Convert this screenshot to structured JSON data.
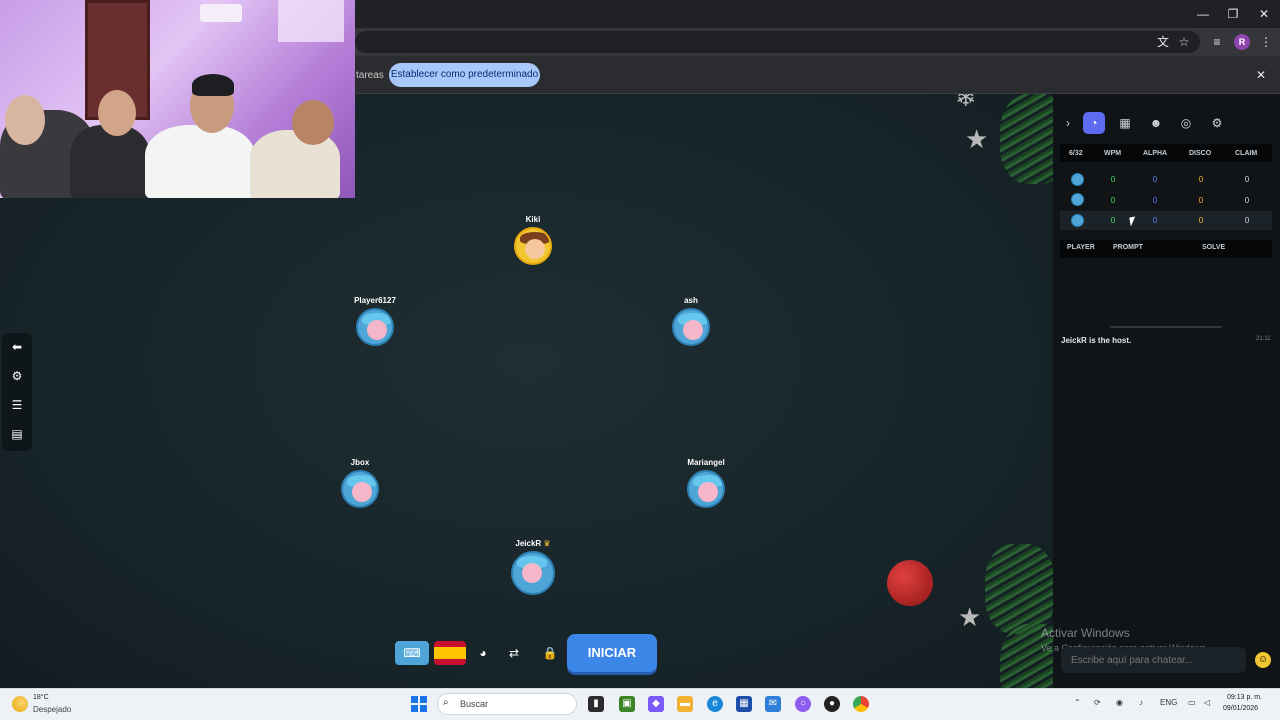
{
  "browser": {
    "infobar_partial_text": "tareas",
    "default_button": "Establecer como predeterminado",
    "profile_initial": "R"
  },
  "game": {
    "players": [
      {
        "name": "Kiki",
        "host": false,
        "avatar": "kiki"
      },
      {
        "name": "Player6127",
        "host": false,
        "avatar": "default"
      },
      {
        "name": "ash",
        "host": false,
        "avatar": "default"
      },
      {
        "name": "Jbox",
        "host": false,
        "avatar": "default"
      },
      {
        "name": "Mariangel",
        "host": false,
        "avatar": "default"
      },
      {
        "name": "JeickR",
        "host": true,
        "avatar": "default"
      }
    ],
    "start_button": "INICIAR"
  },
  "panel": {
    "stats_headers": [
      "6/32",
      "WPM",
      "ALPHA",
      "DISCO",
      "CLAIM"
    ],
    "stats_rows": [
      {
        "wpm": "0",
        "alpha": "0",
        "disco": "0",
        "claim": "0"
      },
      {
        "wpm": "0",
        "alpha": "0",
        "disco": "0",
        "claim": "0"
      },
      {
        "wpm": "0",
        "alpha": "0",
        "disco": "0",
        "claim": "0"
      }
    ],
    "rounds_headers": [
      "PLAYER",
      "PROMPT",
      "SOLVE"
    ],
    "chat": {
      "message": "JeickR is the host.",
      "time": "21:11",
      "placeholder": "Escribe aquí para chatear..."
    }
  },
  "watermark": {
    "title": "Activar Windows",
    "subtitle": "Ve a Configuración para activar Windows."
  },
  "taskbar": {
    "temperature": "18°C",
    "weather": "Despejado",
    "search_placeholder": "Buscar",
    "language": "ENG",
    "time": "09:13 p. m.",
    "date": "09/01/2026"
  },
  "colors": {
    "accent_tab": "#5d6bf0",
    "start_button": "#3b86e6",
    "wpm": "#4cd964",
    "alpha": "#5a7cf5",
    "disco": "#f2b233"
  }
}
